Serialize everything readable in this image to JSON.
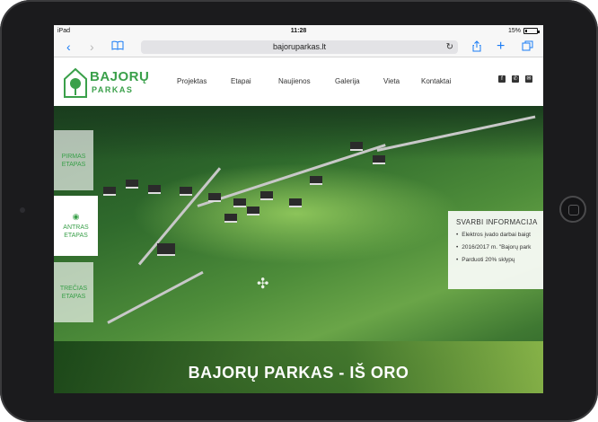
{
  "statusbar": {
    "carrier": "iPad",
    "time": "11:28",
    "battery": "15%",
    "battery_level": 0.15
  },
  "browser": {
    "url": "bajoruparkas.lt"
  },
  "logo": {
    "line1": "BAJORŲ",
    "line2": "PARKAS"
  },
  "nav": {
    "items": [
      "Projektas",
      "Etapai",
      "Naujienos",
      "Galerija",
      "Vieta",
      "Kontaktai"
    ]
  },
  "stages": [
    {
      "line1": "PIRMAS",
      "line2": "ETAPAS",
      "active": false
    },
    {
      "line1": "ANTRAS",
      "line2": "ETAPAS",
      "active": true
    },
    {
      "line1": "TREČIAS",
      "line2": "ETAPAS",
      "active": false
    }
  ],
  "info": {
    "title": "SVARBI INFORMACIJA",
    "items": [
      "Elektros įvado darbai baigt",
      "2016/2017 m. \"Bajorų park",
      "Parduoti 20% sklypų"
    ]
  },
  "hero": {
    "title": "BAJORŲ PARKAS - IŠ ORO"
  },
  "colors": {
    "brand_green": "#3aa04a",
    "safari_blue": "#1a7cf5"
  }
}
